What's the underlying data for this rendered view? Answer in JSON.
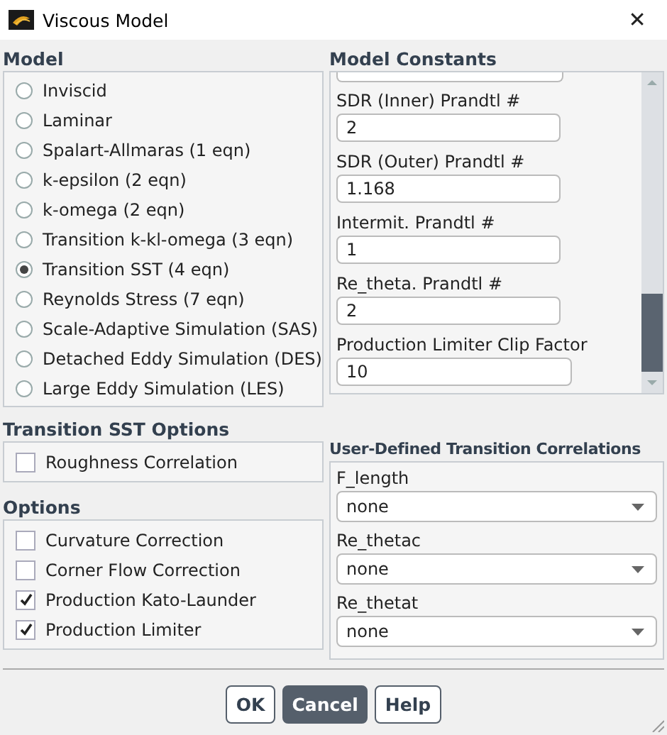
{
  "window": {
    "title": "Viscous Model",
    "close": "✕"
  },
  "model": {
    "title": "Model",
    "options": [
      {
        "label": "Inviscid",
        "selected": false
      },
      {
        "label": "Laminar",
        "selected": false
      },
      {
        "label": "Spalart-Allmaras (1 eqn)",
        "selected": false
      },
      {
        "label": "k-epsilon (2 eqn)",
        "selected": false
      },
      {
        "label": "k-omega (2 eqn)",
        "selected": false
      },
      {
        "label": "Transition k-kl-omega (3 eqn)",
        "selected": false
      },
      {
        "label": "Transition SST (4 eqn)",
        "selected": true
      },
      {
        "label": "Reynolds Stress (7 eqn)",
        "selected": false
      },
      {
        "label": "Scale-Adaptive Simulation (SAS)",
        "selected": false
      },
      {
        "label": "Detached Eddy Simulation (DES)",
        "selected": false
      },
      {
        "label": "Large Eddy Simulation (LES)",
        "selected": false
      }
    ]
  },
  "model_constants": {
    "title": "Model Constants",
    "fields": [
      {
        "label": "SDR (Inner) Prandtl #",
        "value": "2"
      },
      {
        "label": "SDR (Outer) Prandtl #",
        "value": "1.168"
      },
      {
        "label": "Intermit. Prandtl #",
        "value": "1"
      },
      {
        "label": "Re_theta. Prandtl #",
        "value": "2"
      },
      {
        "label": "Production Limiter Clip Factor",
        "value": "10"
      }
    ]
  },
  "transition_sst_options": {
    "title": "Transition SST Options",
    "items": [
      {
        "label": "Roughness Correlation",
        "checked": false
      }
    ]
  },
  "options": {
    "title": "Options",
    "items": [
      {
        "label": "Curvature Correction",
        "checked": false
      },
      {
        "label": "Corner Flow Correction",
        "checked": false
      },
      {
        "label": "Production Kato-Launder",
        "checked": true
      },
      {
        "label": "Production Limiter",
        "checked": true
      }
    ]
  },
  "user_defined_correlations": {
    "title": "User-Defined Transition Correlations",
    "fields": [
      {
        "label": "F_length",
        "value": "none"
      },
      {
        "label": "Re_thetac",
        "value": "none"
      },
      {
        "label": "Re_thetat",
        "value": "none"
      }
    ]
  },
  "buttons": [
    {
      "label": "OK",
      "selected": false
    },
    {
      "label": "Cancel",
      "selected": true
    },
    {
      "label": "Help",
      "selected": false
    }
  ]
}
